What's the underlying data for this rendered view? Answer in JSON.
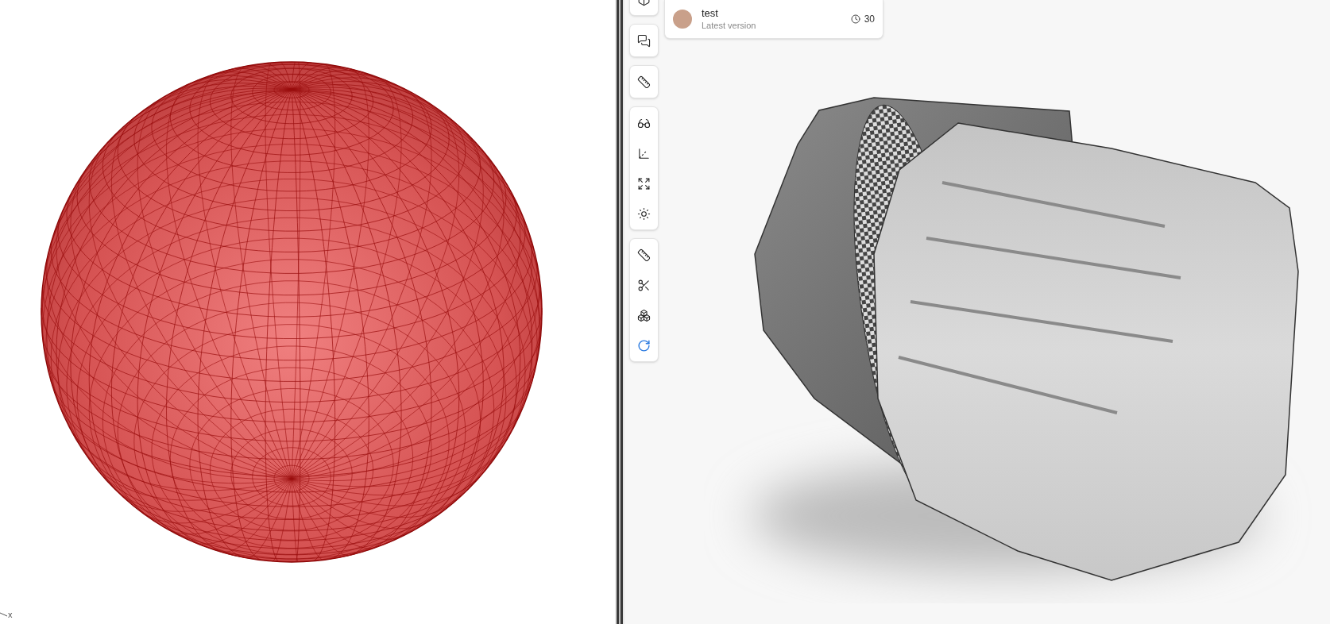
{
  "axes": {
    "x_label": "x"
  },
  "toolbar": {
    "groups": [
      [
        {
          "kind": "cubes",
          "selected": false
        }
      ],
      [
        {
          "kind": "comments",
          "selected": false
        }
      ],
      [
        {
          "kind": "ruler",
          "selected": false
        }
      ],
      [
        {
          "kind": "glasses",
          "selected": false
        },
        {
          "kind": "axes",
          "selected": false
        },
        {
          "kind": "fullscreen",
          "selected": false
        },
        {
          "kind": "light",
          "selected": false
        }
      ],
      [
        {
          "kind": "section",
          "selected": false
        },
        {
          "kind": "scissors",
          "selected": false
        },
        {
          "kind": "explode",
          "selected": false
        },
        {
          "kind": "rotate",
          "selected": true
        }
      ]
    ]
  },
  "version_card": {
    "user": "test",
    "subtitle": "Latest version",
    "count": "30"
  }
}
